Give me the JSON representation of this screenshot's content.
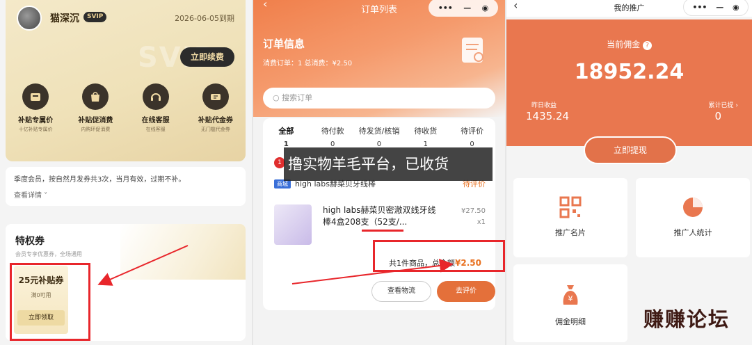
{
  "panel1": {
    "user_name": "猫深沉",
    "svip_badge": "SVIP",
    "expire": "2026-06-05到期",
    "bg_text": "SVIP",
    "renew_btn": "立即续费",
    "perks": [
      {
        "title": "补贴专属价",
        "sub": "十亿补贴专属价",
        "icon": "price-tag-icon"
      },
      {
        "title": "补贴促消费",
        "sub": "内购环促消费",
        "icon": "shopping-bag-icon"
      },
      {
        "title": "在线客服",
        "sub": "在线客服",
        "icon": "headset-icon"
      },
      {
        "title": "补贴代金券",
        "sub": "无门槛代金券",
        "icon": "ticket-icon"
      }
    ],
    "notice_text": "季度会员，按自然月发券共3次，当月有效，过期不补。",
    "notice_more": "查看详情 ˅",
    "privilege_title": "特权券",
    "privilege_sub": "会员专享优惠券，全场通用",
    "coupon_title": "25元补贴券",
    "coupon_cond": "满0可用",
    "coupon_btn": "立即领取"
  },
  "panel2": {
    "nav_title": "订单列表",
    "back_glyph": "‹",
    "capsule": [
      "•••",
      "—",
      "◉"
    ],
    "orders_title": "订单信息",
    "orders_sub": "消费订单：1 总消费：¥2.50",
    "search_placeholder": "搜索订单",
    "tabs": [
      {
        "label": "全部",
        "count": "1"
      },
      {
        "label": "待付款",
        "count": "0"
      },
      {
        "label": "待发货/核销",
        "count": "0"
      },
      {
        "label": "待收货",
        "count": "1"
      },
      {
        "label": "待评价",
        "count": "0"
      }
    ],
    "badge_count": "1",
    "overlay_text": "撸实物羊毛平台，已收货",
    "shop_tag": "商城",
    "shop_name": "high labs赫菜贝牙线棒",
    "order_status": "待评价",
    "product_title": "high labs赫菜贝密澈双线牙线棒4盒208支（52支/...",
    "product_price": "¥27.50",
    "product_qty": "x1",
    "total_text": "共1件商品，总金额",
    "total_amount": "¥2.50",
    "btn_logistics": "查看物流",
    "btn_review": "去评价"
  },
  "panel3": {
    "nav_title": "我的推广",
    "back_glyph": "‹",
    "capsule": [
      "•••",
      "—",
      "◉"
    ],
    "commission_label": "当前佣金",
    "commission_value": "18952.24",
    "yesterday_label": "昨日收益",
    "yesterday_value": "1435.24",
    "withdrawn_label": "累计已提 ›",
    "withdrawn_value": "0",
    "withdraw_btn": "立即提现",
    "tiles": [
      {
        "label": "推广名片",
        "icon": "qr-code-icon"
      },
      {
        "label": "推广人统计",
        "icon": "pie-chart-icon"
      },
      {
        "label": "佣金明细",
        "icon": "money-bag-icon"
      }
    ],
    "watermark": "赚赚论坛"
  },
  "colors": {
    "accent_orange": "#e9774f",
    "gold": "#efe1b8",
    "annotation_red": "#e8262b"
  }
}
